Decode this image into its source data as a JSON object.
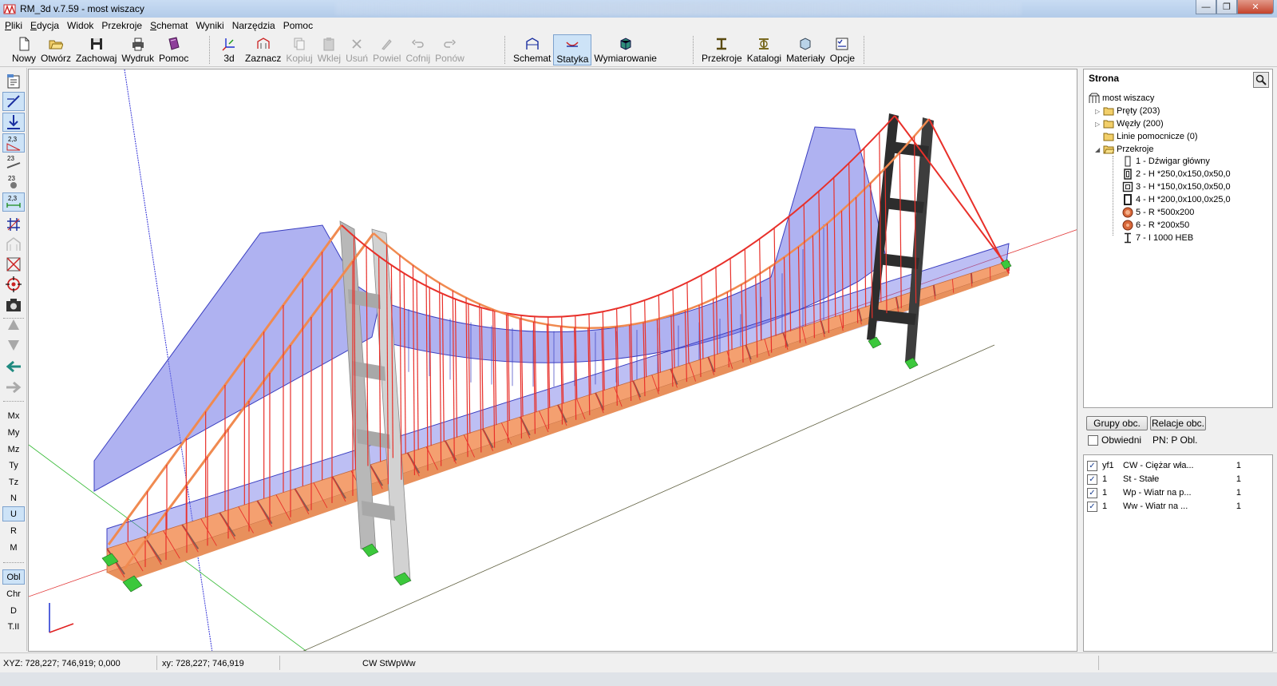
{
  "window": {
    "title": "RM_3d v.7.59 - most wiszacy"
  },
  "menu": [
    {
      "ul": "P",
      "rest": "liki"
    },
    {
      "ul": "E",
      "rest": "dycja"
    },
    {
      "ul": "",
      "rest": "Widok"
    },
    {
      "ul": "",
      "rest": "Przekroje"
    },
    {
      "ul": "S",
      "rest": "chemat"
    },
    {
      "ul": "",
      "rest": "Wyniki"
    },
    {
      "ul": "",
      "rest": "Narzędzia"
    },
    {
      "ul": "",
      "rest": "Pomoc"
    }
  ],
  "toolbar": {
    "new": "Nowy",
    "open": "Otwórz",
    "save": "Zachowaj",
    "print": "Wydruk",
    "help": "Pomoc",
    "view3d": "3d",
    "select": "Zaznacz",
    "copy": "Kopiuj",
    "paste": "Wklej",
    "delete": "Usuń",
    "repeat": "Powiel",
    "undo": "Cofnij",
    "redo": "Ponów",
    "schema": "Schemat",
    "statics": "Statyka",
    "design": "Wymiarowanie",
    "sections": "Przekroje",
    "catalogs": "Katalogi",
    "materials": "Materiały",
    "options": "Opcje"
  },
  "left_toolbar": {
    "labels": [
      "Mx",
      "My",
      "Mz",
      "Ty",
      "Tz",
      "N",
      "U",
      "R",
      "M"
    ],
    "active_label": "U",
    "labels2": [
      "Obl",
      "Chr",
      "D",
      "T.II"
    ],
    "active_label2": "Obl",
    "num_a": "2,3",
    "num_b": "23",
    "num_c": "23",
    "num_d": "2,3"
  },
  "tree": {
    "header": "Strona",
    "root": "most wiszacy",
    "items": [
      {
        "label": "Pręty (203)",
        "expand": "▷"
      },
      {
        "label": "Węzły (200)",
        "expand": "▷"
      },
      {
        "label": "Linie pomocnicze (0)",
        "expand": ""
      },
      {
        "label": "Przekroje",
        "expand": "◢"
      }
    ],
    "sections": [
      {
        "label": "1 - Dźwigar główny",
        "icon": "rect-outline-icon"
      },
      {
        "label": "2 - H *250,0x150,0x50,0",
        "icon": "box-section-icon"
      },
      {
        "label": "3 - H *150,0x150,0x50,0",
        "icon": "square-section-icon"
      },
      {
        "label": "4 - H *200,0x100,0x25,0",
        "icon": "hollow-rect-icon"
      },
      {
        "label": "5 - R *500x200",
        "icon": "round-tube-icon"
      },
      {
        "label": "6 - R *200x50",
        "icon": "round-tube-icon"
      },
      {
        "label": "7 - I 1000 HEB",
        "icon": "i-beam-icon"
      }
    ]
  },
  "groups": {
    "btn1": "Grupy obc.",
    "btn2": "Relacje obc.",
    "envelope": "Obwiedni",
    "pn": "PN:  P Obl."
  },
  "loads": [
    {
      "checked": "✓",
      "id": "yf1",
      "name": "CW - Ciężar wła...",
      "factor": "1"
    },
    {
      "checked": "✓",
      "id": "1",
      "name": "St - Stałe",
      "factor": "1"
    },
    {
      "checked": "✓",
      "id": "1",
      "name": "Wp - Wiatr na p...",
      "factor": "1"
    },
    {
      "checked": "✓",
      "id": "1",
      "name": "Ww - Wiatr na ...",
      "factor": "1"
    }
  ],
  "status": {
    "xyz": "XYZ: 728,227; 746,919; 0,000",
    "xy": "xy: 728,227; 746,919",
    "cases": "CW StWpWw"
  },
  "colors": {
    "deck": "#f4a070",
    "cable": "#e8302a",
    "diagram": "#6d72e6",
    "tower": "#c8c8c8",
    "support": "#3cc83c"
  }
}
